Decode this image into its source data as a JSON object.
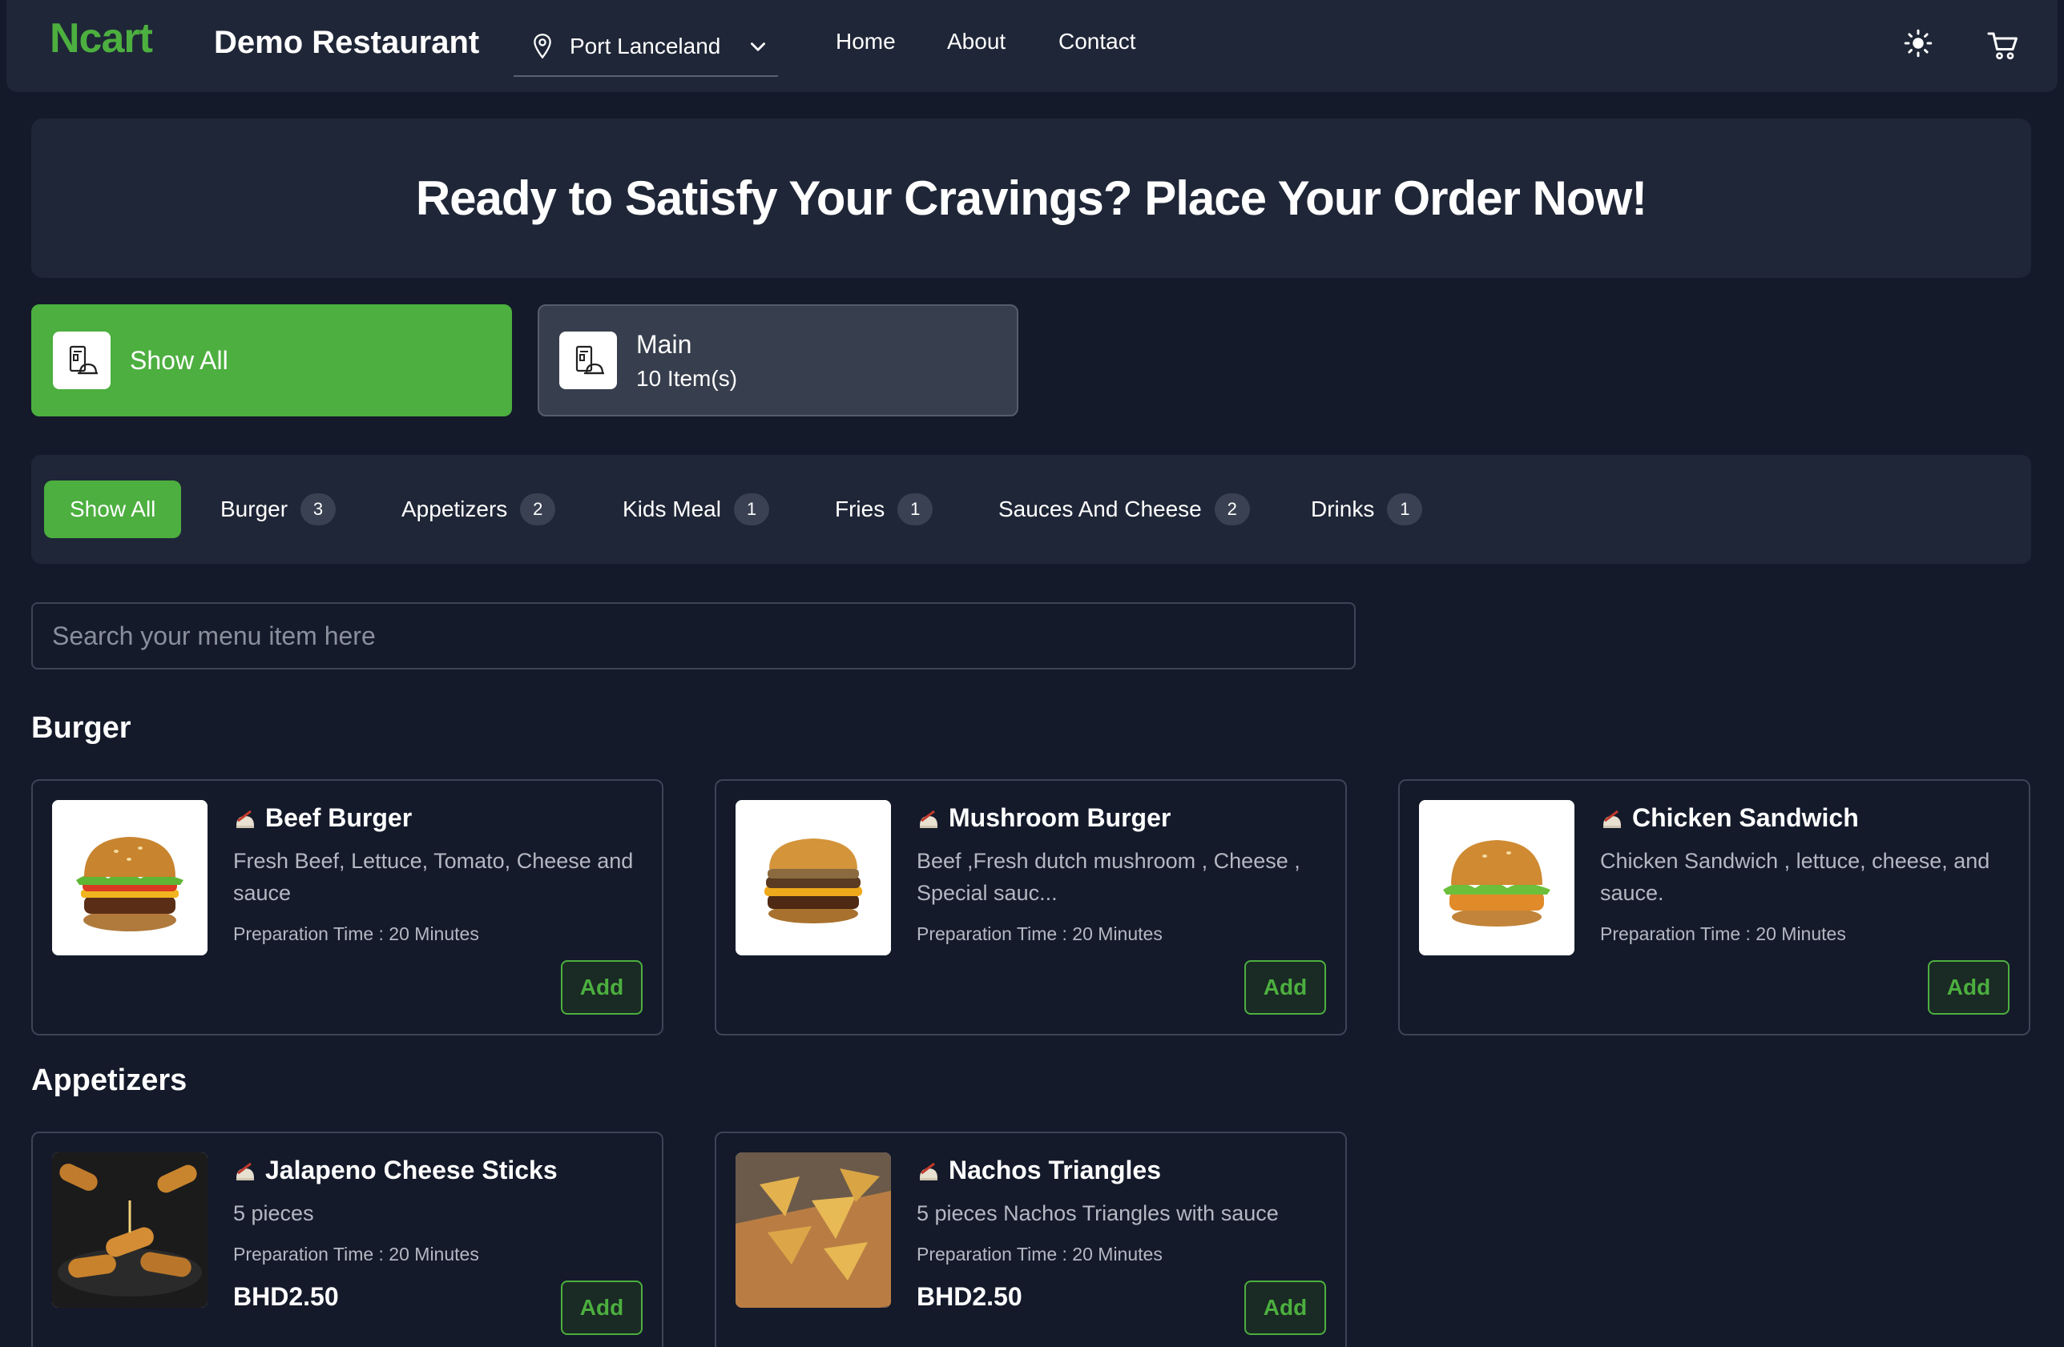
{
  "header": {
    "logo": "Ncart",
    "restaurant_name": "Demo Restaurant",
    "location": "Port Lanceland",
    "nav": {
      "home": "Home",
      "about": "About",
      "contact": "Contact"
    }
  },
  "hero": {
    "title": "Ready to Satisfy Your Cravings? Place Your Order Now!"
  },
  "menus": [
    {
      "title": "Show All",
      "subtitle": ""
    },
    {
      "title": "Main",
      "subtitle": "10 Item(s)"
    }
  ],
  "categories": [
    {
      "label": "Show All",
      "count": ""
    },
    {
      "label": "Burger",
      "count": "3"
    },
    {
      "label": "Appetizers",
      "count": "2"
    },
    {
      "label": "Kids Meal",
      "count": "1"
    },
    {
      "label": "Fries",
      "count": "1"
    },
    {
      "label": "Sauces And Cheese",
      "count": "2"
    },
    {
      "label": "Drinks",
      "count": "1"
    }
  ],
  "search": {
    "placeholder": "Search your menu item here"
  },
  "sections": [
    {
      "title": "Burger",
      "items": [
        {
          "name": "Beef Burger",
          "description": "Fresh Beef, Lettuce, Tomato, Cheese and sauce",
          "prep": "Preparation Time : 20 Minutes",
          "price": "",
          "add": "Add"
        },
        {
          "name": "Mushroom Burger",
          "description": "Beef ,Fresh dutch mushroom , Cheese , Special sauc...",
          "prep": "Preparation Time : 20 Minutes",
          "price": "",
          "add": "Add"
        },
        {
          "name": "Chicken Sandwich",
          "description": "Chicken Sandwich , lettuce, cheese, and sauce.",
          "prep": "Preparation Time : 20 Minutes",
          "price": "",
          "add": "Add"
        }
      ]
    },
    {
      "title": "Appetizers",
      "items": [
        {
          "name": "Jalapeno Cheese Sticks",
          "description": "5 pieces",
          "prep": "Preparation Time : 20 Minutes",
          "price": "BHD2.50",
          "add": "Add"
        },
        {
          "name": "Nachos Triangles",
          "description": "5 pieces Nachos Triangles with sauce",
          "prep": "Preparation Time : 20 Minutes",
          "price": "BHD2.50",
          "add": "Add"
        }
      ]
    }
  ],
  "colors": {
    "accent": "#4caf3f",
    "background": "#141a2a",
    "panel": "#1f2637"
  },
  "icons": {
    "location": "map-pin-icon",
    "dropdown": "chevron-down-icon",
    "theme": "sun-icon",
    "cart": "shopping-cart-icon",
    "menu": "restaurant-menu-icon",
    "food": "food-icon"
  }
}
